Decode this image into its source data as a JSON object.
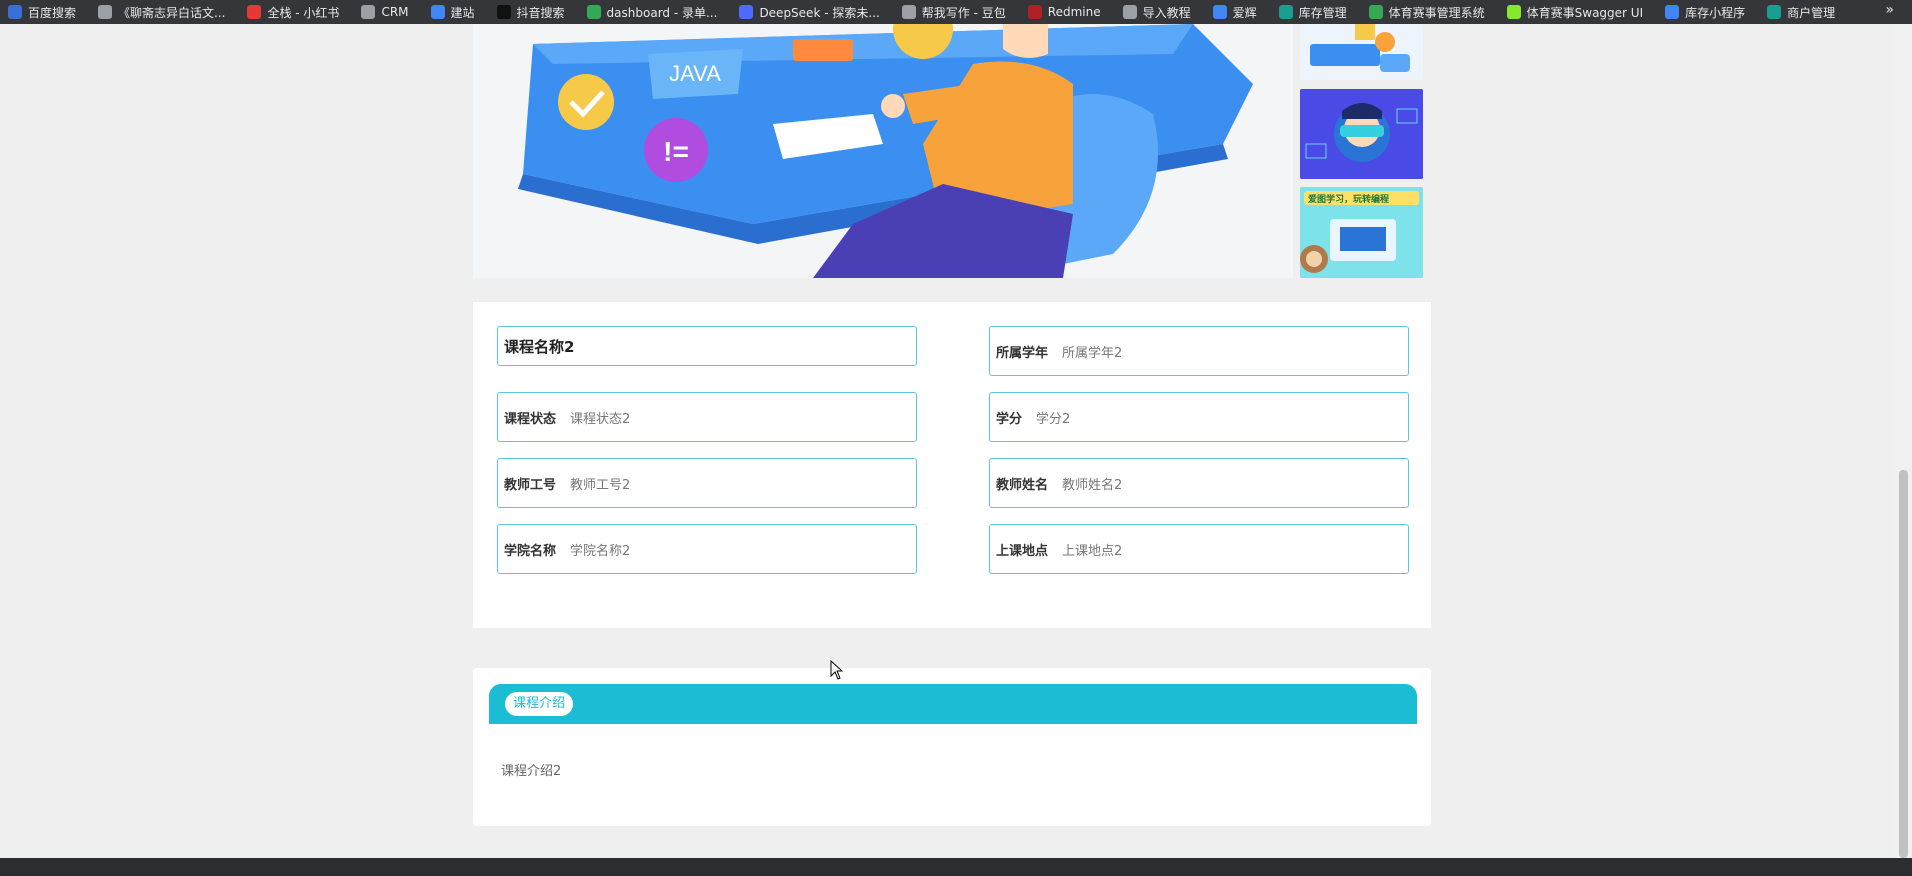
{
  "bookmarks": [
    {
      "label": "百度搜索",
      "color": "#3b6fd8"
    },
    {
      "label": "《聊斋志异白话文...",
      "color": "#9aa0a6"
    },
    {
      "label": "全栈 - 小红书",
      "color": "#e53935"
    },
    {
      "label": "CRM",
      "color": "#9aa0a6"
    },
    {
      "label": "建站",
      "color": "#4285f4"
    },
    {
      "label": "抖音搜索",
      "color": "#111111"
    },
    {
      "label": "dashboard - 录单...",
      "color": "#34a853"
    },
    {
      "label": "DeepSeek - 探索未...",
      "color": "#4d6bfe"
    },
    {
      "label": "帮我写作 - 豆包",
      "color": "#9aa0a6"
    },
    {
      "label": "Redmine",
      "color": "#b32024"
    },
    {
      "label": "导入教程",
      "color": "#9aa0a6"
    },
    {
      "label": "爱辉",
      "color": "#4285f4"
    },
    {
      "label": "库存管理",
      "color": "#1a9e8f"
    },
    {
      "label": "体育赛事管理系统",
      "color": "#34a853"
    },
    {
      "label": "体育赛事Swagger UI",
      "color": "#85ea2d"
    },
    {
      "label": "库存小程序",
      "color": "#4285f4"
    },
    {
      "label": "商户管理",
      "color": "#1a9e8f"
    }
  ],
  "bookmarks_more": "»",
  "course": {
    "name": "课程名称2",
    "fields_left": [
      {
        "label": "课程状态",
        "value": "课程状态2"
      },
      {
        "label": "教师工号",
        "value": "教师工号2"
      },
      {
        "label": "学院名称",
        "value": "学院名称2"
      }
    ],
    "fields_right": [
      {
        "label": "所属学年",
        "value": "所属学年2"
      },
      {
        "label": "学分",
        "value": "学分2"
      },
      {
        "label": "教师姓名",
        "value": "教师姓名2"
      },
      {
        "label": "上课地点",
        "value": "上课地点2"
      }
    ]
  },
  "intro": {
    "tab_label": "课程介绍",
    "text": "课程介绍2"
  },
  "banner": {
    "java_label": "JAVA",
    "neq_label": "!=",
    "promo_text": "爱图学习，玩转编程"
  }
}
